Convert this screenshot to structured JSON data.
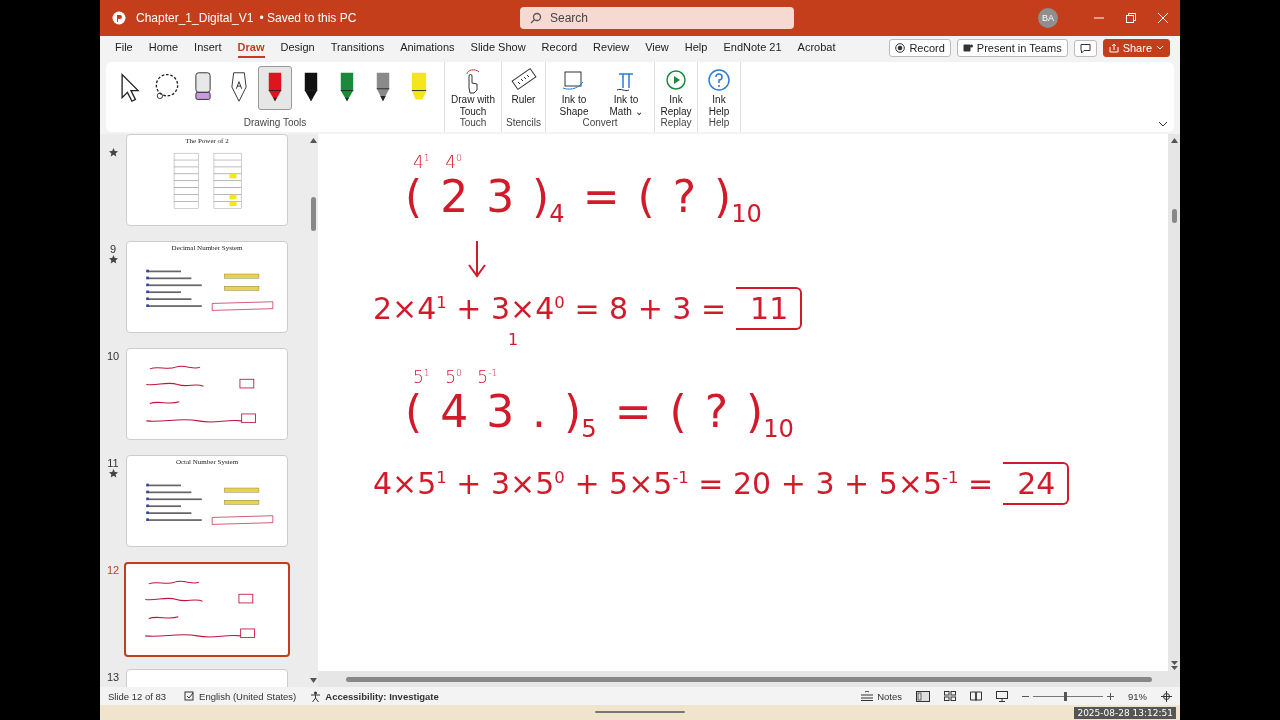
{
  "title_bar": {
    "document_title": "Chapter_1_Digital_V1",
    "save_status": "• Saved to this PC",
    "search": {
      "placeholder": "Search"
    },
    "avatar": "BA"
  },
  "menu_tabs": [
    {
      "label": "File",
      "selected": false
    },
    {
      "label": "Home",
      "selected": false
    },
    {
      "label": "Insert",
      "selected": false
    },
    {
      "label": "Draw",
      "selected": true
    },
    {
      "label": "Design",
      "selected": false
    },
    {
      "label": "Transitions",
      "selected": false
    },
    {
      "label": "Animations",
      "selected": false
    },
    {
      "label": "Slide Show",
      "selected": false
    },
    {
      "label": "Record",
      "selected": false
    },
    {
      "label": "Review",
      "selected": false
    },
    {
      "label": "View",
      "selected": false
    },
    {
      "label": "Help",
      "selected": false
    },
    {
      "label": "EndNote 21",
      "selected": false
    },
    {
      "label": "Acrobat",
      "selected": false
    }
  ],
  "menu_actions": {
    "record": "Record",
    "present": "Present in Teams",
    "share": "Share"
  },
  "ribbon": {
    "drawing_tools_label": "Drawing Tools",
    "drawing_tools": [
      {
        "kind": "select",
        "selected": false
      },
      {
        "kind": "lasso",
        "selected": false
      },
      {
        "kind": "eraser",
        "selected": false
      },
      {
        "kind": "action-pen",
        "selected": false
      },
      {
        "kind": "pen",
        "color": "#e0141e",
        "selected": true
      },
      {
        "kind": "pen",
        "color": "#111111",
        "selected": false
      },
      {
        "kind": "pen",
        "color": "#1a8a3a",
        "selected": false
      },
      {
        "kind": "pencil",
        "color": "#8a8a8a",
        "selected": false
      },
      {
        "kind": "highlighter",
        "color": "#f5e61c",
        "selected": false
      }
    ],
    "groups": [
      {
        "label": "Touch",
        "buttons": [
          {
            "kind": "touch",
            "label": "Draw with Touch"
          }
        ]
      },
      {
        "label": "Stencils",
        "buttons": [
          {
            "kind": "ruler",
            "label": "Ruler"
          }
        ]
      },
      {
        "label": "Convert",
        "buttons": [
          {
            "kind": "shape",
            "label": "Ink to Shape"
          },
          {
            "kind": "math",
            "label": "Ink to Math ⌄"
          }
        ]
      },
      {
        "label": "Replay",
        "buttons": [
          {
            "kind": "replay",
            "label": "Ink Replay"
          }
        ]
      },
      {
        "label": "Help",
        "buttons": [
          {
            "kind": "help",
            "label": "Ink Help"
          }
        ]
      }
    ]
  },
  "slides_panel": [
    {
      "star": true,
      "title": "The Power of 2",
      "kind": "table",
      "selected": false
    },
    {
      "number": "9",
      "star": true,
      "title": "Decimal Number System",
      "kind": "bullets",
      "selected": false
    },
    {
      "number": "10",
      "star": false,
      "kind": "ink",
      "selected": false
    },
    {
      "number": "11",
      "star": true,
      "title": "Octal Number System",
      "kind": "bullets",
      "selected": false
    },
    {
      "number": "12",
      "star": false,
      "kind": "ink",
      "selected": true
    },
    {
      "number": "13",
      "star": false,
      "kind": "blank",
      "selected": false
    }
  ],
  "slide": {
    "ink": [
      {
        "kind": "weights",
        "text": "4$^{1}$ 4$^{0}$"
      },
      {
        "kind": "question",
        "text": "( 2 3 )$_{4}$ = ( ? )$_{10}$"
      },
      {
        "kind": "arrow"
      },
      {
        "kind": "expansion",
        "text": "2×4$^{1}$ + 3×4$^{0}$ = 8 + 3 =",
        "answer": "11"
      },
      {
        "kind": "note",
        "text": "1"
      },
      {
        "kind": "weights",
        "text": "5$^{1}$ 5$^{0}$ 5$^{-1}$"
      },
      {
        "kind": "question",
        "text": "( 4 3 . )$_{5}$ = ( ? )$_{10}$"
      },
      {
        "kind": "expansion",
        "text": "4×5$^{1}$ + 3×5$^{0}$ + 5×5$^{-1}$ = 20 + 3 + 5×5$^{-1}$ =",
        "answer": "24"
      }
    ]
  },
  "status_bar": {
    "slide": "Slide 12 of 83",
    "language": "English (United States)",
    "accessibility": "Accessibility: Investigate",
    "notes": "Notes",
    "zoom": {
      "level": 0.46
    },
    "zoom_reading": "91%"
  },
  "timestamp": "2025-08-28 13:12:51"
}
